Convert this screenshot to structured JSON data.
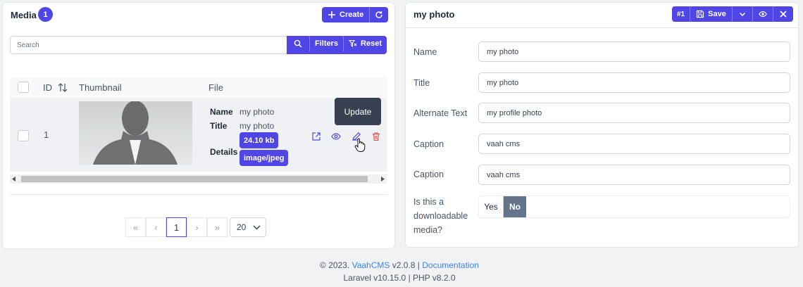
{
  "media_panel": {
    "title": "Media",
    "count": "1",
    "create_label": "Create",
    "search": {
      "placeholder": "Search",
      "filters_label": "Filters",
      "reset_label": "Reset"
    },
    "columns": {
      "id": "ID",
      "thumbnail": "Thumbnail",
      "file": "File"
    },
    "rows": [
      {
        "id": "1",
        "name_label": "Name",
        "name": "my photo",
        "title_label": "Title",
        "title": "my photo",
        "details_label": "Details",
        "size": "24.10 kb",
        "mime": "image/jpeg"
      }
    ],
    "tooltip": "Update",
    "pagination": {
      "current_page": "1",
      "per_page": "20"
    }
  },
  "detail_panel": {
    "title": "my photo",
    "id_badge": "#1",
    "save_label": "Save",
    "fields": [
      {
        "label": "Name",
        "value": "my photo"
      },
      {
        "label": "Title",
        "value": "my photo"
      },
      {
        "label": "Alternate Text",
        "value": "my profile photo"
      },
      {
        "label": "Caption",
        "value": "vaah cms"
      },
      {
        "label": "Caption",
        "value": "vaah cms"
      }
    ],
    "downloadable": {
      "label": "Is this a downloadable media?",
      "yes": "Yes",
      "no": "No",
      "selected": "No"
    }
  },
  "footer": {
    "copyright": "© 2023.",
    "app_link": "VaahCMS",
    "version": "v2.0.8 |",
    "docs_link": "Documentation",
    "stack": "Laravel v10.15.0 | PHP v8.2.0"
  },
  "colors": {
    "primary": "#4f46e5",
    "danger": "#ef4444",
    "toggle_active": "#64748b"
  }
}
